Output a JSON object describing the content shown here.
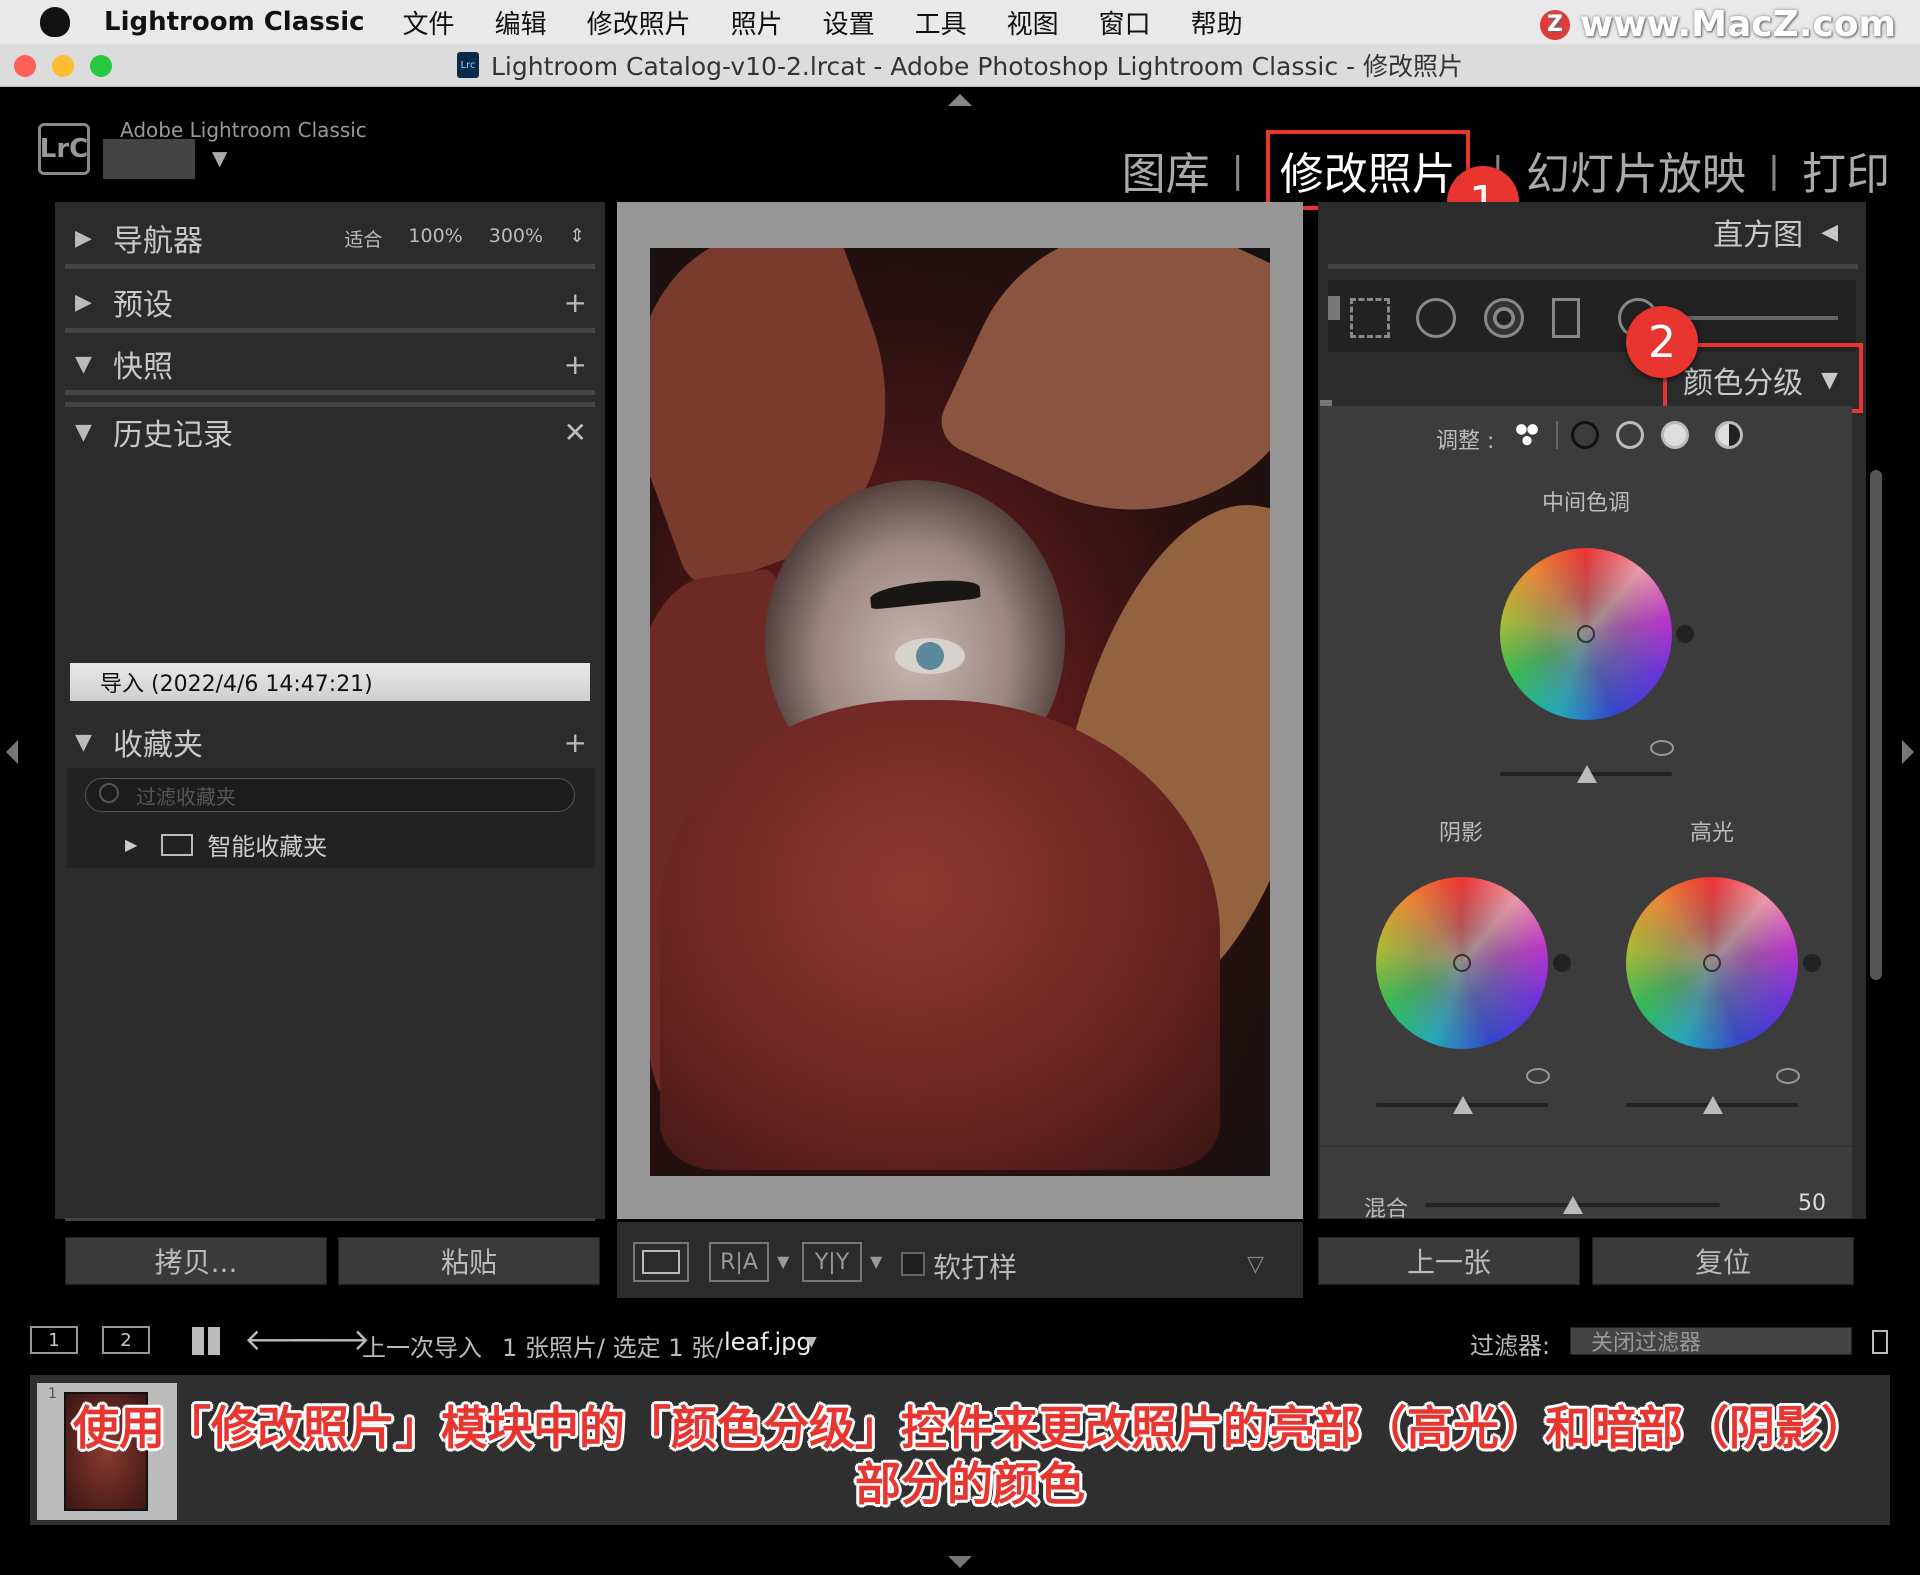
{
  "menubar": {
    "app_name": "Lightroom Classic",
    "items": [
      "文件",
      "编辑",
      "修改照片",
      "照片",
      "设置",
      "工具",
      "视图",
      "窗口",
      "帮助"
    ],
    "watermark": "www.MacZ.com",
    "watermark_badge": "Z"
  },
  "window": {
    "title": "Lightroom Catalog-v10-2.lrcat - Adobe Photoshop Lightroom Classic - 修改照片",
    "catalog_icon": "Lrc"
  },
  "header": {
    "logo": "LrC",
    "brand": "Adobe Lightroom Classic",
    "modules": [
      "图库",
      "修改照片",
      "幻灯片放映",
      "打印"
    ],
    "active_module": "修改照片",
    "separator": "|"
  },
  "annotations": {
    "badge1": "1",
    "badge2": "2",
    "accent": "#e8352f"
  },
  "left_panel": {
    "navigator": {
      "label": "导航器",
      "zoom_fit": "适合",
      "zoom_100": "100%",
      "zoom_300": "300%"
    },
    "presets": {
      "label": "预设"
    },
    "snapshots": {
      "label": "快照"
    },
    "history": {
      "label": "历史记录",
      "entry": "导入 (2022/4/6 14:47:21)"
    },
    "collections": {
      "label": "收藏夹",
      "filter_placeholder": "过滤收藏夹",
      "smart": "智能收藏夹"
    },
    "copy_button": "拷贝...",
    "paste_button": "粘贴"
  },
  "toolbar": {
    "softproof": "软打样",
    "ra": "R|A",
    "yy": "Y|Y"
  },
  "right_panel": {
    "histogram": "直方图",
    "color_grading": "颜色分级",
    "adjust_label": "调整 :",
    "midtones": "中间色调",
    "shadows": "阴影",
    "highlights": "高光",
    "blend_label": "混合",
    "blend_value": "50",
    "prev_button": "上一张",
    "reset_button": "复位"
  },
  "filmstrip": {
    "page1": "1",
    "page2": "2",
    "source": "上一次导入",
    "count": "1 张照片/ 选定 1 张/",
    "filename": "leaf.jpg",
    "filter_label": "过滤器:",
    "filter_value": "关闭过滤器",
    "thumb_index": "1"
  },
  "caption": {
    "line1": "使用「修改照片」模块中的「颜色分级」控件来更改照片的亮部（高光）和暗部（阴影）",
    "line2": "部分的颜色"
  }
}
